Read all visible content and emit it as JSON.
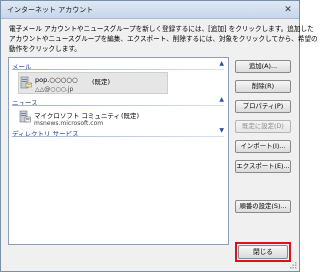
{
  "window": {
    "title": "インターネット アカウント",
    "close_glyph": "✕"
  },
  "description": {
    "line1": "電子メール アカウントやニュースグループを新しく登録するには、[追加] をクリックします。追加した",
    "line2": "アカウントやニュースグループを編集、エクスポート、削除するには、対象をクリックしてから、希望の",
    "line3": "動作をクリックします。"
  },
  "list": {
    "groups": [
      {
        "header": "メール"
      },
      {
        "header": "ニュース"
      },
      {
        "header": "ディレクトリ サービス"
      }
    ],
    "mail_account": {
      "name": "pop.○○○○○",
      "default_label": "(既定)",
      "server": "△△@○○○.jp"
    },
    "news_account": {
      "name": "マイクロソフト コミュニティ",
      "default_label": "(既定)",
      "server": "msnews.microsoft.com"
    }
  },
  "buttons": {
    "add": "追加(A)...",
    "remove": "削除(R)",
    "properties": "プロパティ(P)",
    "set_default": "既定に設定(D)",
    "import": "インポート(I)...",
    "export": "エクスポート(E)...",
    "order": "順番の設定(S)...",
    "close": "閉じる"
  },
  "colors": {
    "group_header": "#1e3f8a",
    "close_highlight": "#d8141b"
  }
}
